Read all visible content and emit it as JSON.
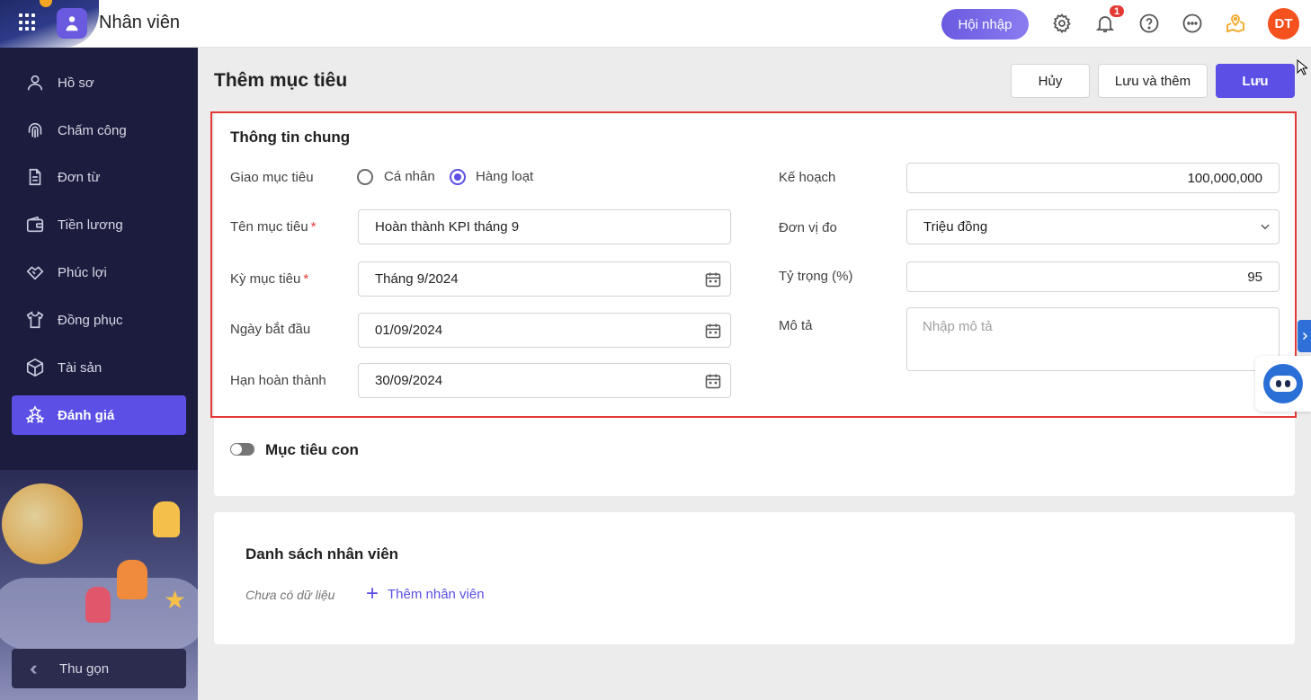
{
  "topbar": {
    "app_title": "Nhân viên",
    "hoinhap_label": "Hội nhập",
    "notification_count": "1",
    "avatar_initials": "DT"
  },
  "sidebar": {
    "items": [
      {
        "label": "Hồ sơ",
        "icon": "user-icon"
      },
      {
        "label": "Chấm công",
        "icon": "fingerprint-icon"
      },
      {
        "label": "Đơn từ",
        "icon": "document-icon"
      },
      {
        "label": "Tiền lương",
        "icon": "wallet-icon"
      },
      {
        "label": "Phúc lợi",
        "icon": "handshake-icon"
      },
      {
        "label": "Đồng phục",
        "icon": "shirt-icon"
      },
      {
        "label": "Tài sản",
        "icon": "box-icon"
      },
      {
        "label": "Đánh giá",
        "icon": "stars-icon",
        "active": true
      }
    ],
    "collapse_label": "Thu gọn"
  },
  "header": {
    "title": "Thêm mục tiêu",
    "cancel_label": "Hủy",
    "save_add_label": "Lưu và thêm",
    "save_label": "Lưu"
  },
  "general": {
    "title": "Thông tin chung",
    "assign_label": "Giao mục tiêu",
    "assign_options": [
      "Cá nhân",
      "Hàng loạt"
    ],
    "assign_selected": "Hàng loạt",
    "name_label": "Tên mục tiêu",
    "name_value": "Hoàn thành KPI tháng 9",
    "period_label": "Kỳ mục tiêu",
    "period_value": "Tháng 9/2024",
    "start_label": "Ngày bắt đầu",
    "start_value": "01/09/2024",
    "due_label": "Hạn hoàn thành",
    "due_value": "30/09/2024",
    "plan_label": "Kế hoạch",
    "plan_value": "100,000,000",
    "unit_label": "Đơn vị đo",
    "unit_value": "Triệu đồng",
    "weight_label": "Tỷ trọng (%)",
    "weight_value": "95",
    "desc_label": "Mô tả",
    "desc_placeholder": "Nhập mô tả",
    "required_mark": "*"
  },
  "subgoal": {
    "label": "Mục tiêu con",
    "enabled": false
  },
  "employees": {
    "title": "Danh sách nhân viên",
    "empty_text": "Chưa có dữ liệu",
    "add_label": "Thêm nhân viên"
  },
  "colors": {
    "primary": "#5b4fe6",
    "sidebar_bg": "#1c1d3e",
    "highlight": "#e53935",
    "avatar": "#f4511e"
  }
}
